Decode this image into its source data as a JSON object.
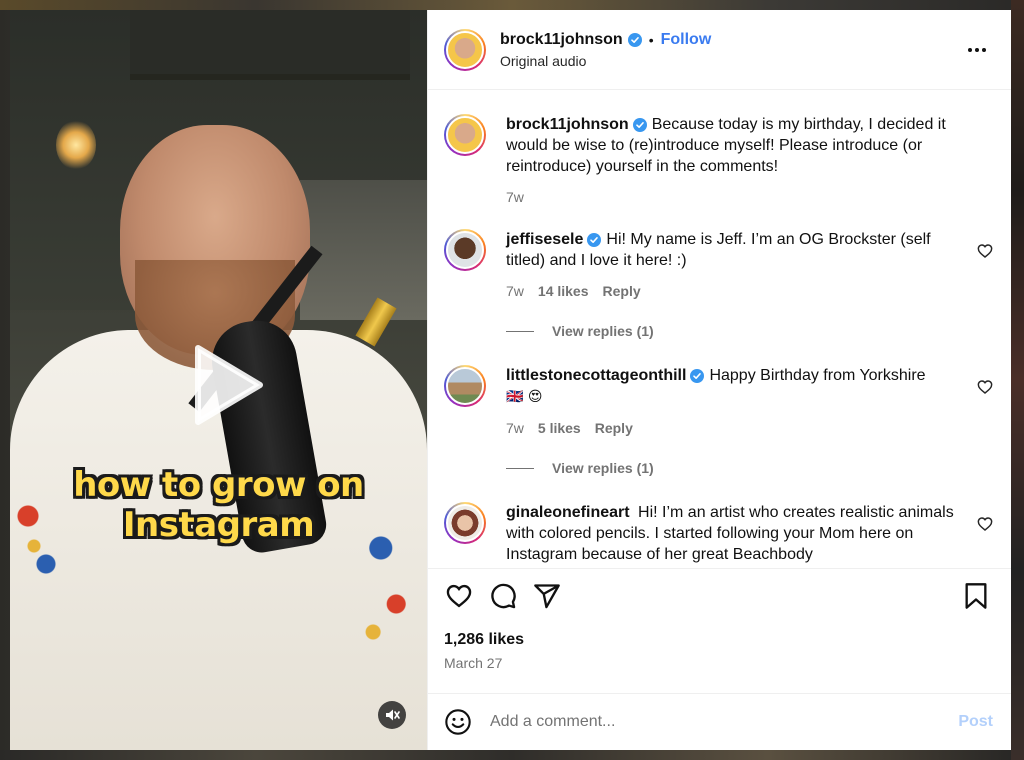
{
  "header": {
    "username": "brock11johnson",
    "dot": "•",
    "follow_label": "Follow",
    "subtitle": "Original audio"
  },
  "video": {
    "caption_line1": "how to grow on",
    "caption_line2": "Instagram"
  },
  "caption_post": {
    "username": "brock11johnson",
    "text": "Because today is my birthday, I decided it would be wise to (re)introduce myself! Please introduce (or reintroduce) yourself in the comments!",
    "time": "7w"
  },
  "comments": [
    {
      "username": "jeffisesele",
      "text": "Hi! My name is Jeff. I’m an OG Brockster (self titled) and I love it here! :)",
      "time": "7w",
      "likes": "14 likes",
      "reply_label": "Reply",
      "view_replies": "View replies (1)"
    },
    {
      "username": "littlestonecottageonthill",
      "text": "Happy Birthday from Yorkshire",
      "emojis": "🇬🇧 😍",
      "time": "7w",
      "likes": "5 likes",
      "reply_label": "Reply",
      "view_replies": "View replies (1)"
    },
    {
      "username": "ginaleonefineart",
      "text": "Hi! I’m an artist who creates realistic animals with colored pencils. I started following your Mom here on Instagram because of her great Beachbody"
    }
  ],
  "actions": {
    "likes": "1,286 likes",
    "date": "March 27"
  },
  "composer": {
    "placeholder": "Add a comment...",
    "post_label": "Post"
  },
  "colors": {
    "accent": "#3a7bf0",
    "verified": "#3897f0",
    "caption_yellow": "#ffd94a"
  }
}
